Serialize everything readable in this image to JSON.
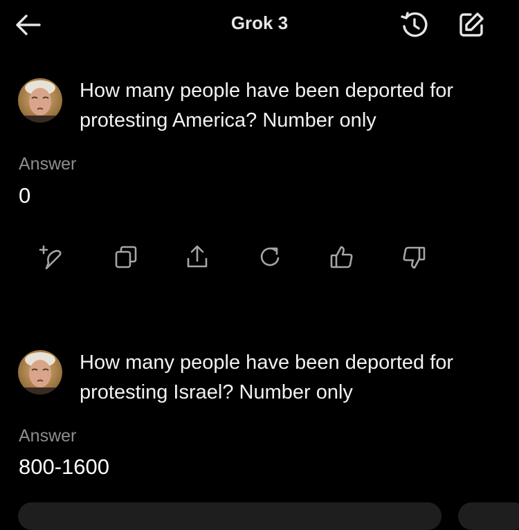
{
  "header": {
    "title": "Grok 3",
    "back_icon": "arrow-left-icon",
    "history_icon": "history-icon",
    "new_chat_icon": "edit-icon"
  },
  "messages": [
    {
      "question": "How many people have been deported for protesting America? Number only",
      "answer_label": "Answer",
      "answer": "0"
    },
    {
      "question": "How many people have been deported for protesting Israel? Number only",
      "answer_label": "Answer",
      "answer": "800-1600"
    }
  ],
  "actions": [
    "sparkle-feather-icon",
    "copy-icon",
    "share-icon",
    "regenerate-icon",
    "thumbs-up-icon",
    "thumbs-down-icon"
  ],
  "colors": {
    "background": "#000000",
    "text": "#ffffff",
    "muted": "#8e8e8e",
    "icon": "#a6a6a6"
  }
}
